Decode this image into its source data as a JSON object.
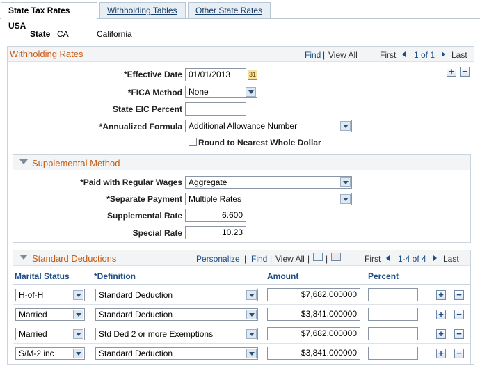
{
  "tabs": [
    {
      "label": "State Tax Rates USA"
    },
    {
      "label": "Withholding Tables"
    },
    {
      "label": "Other State Rates"
    }
  ],
  "state": {
    "label": "State",
    "code": "CA",
    "name": "California"
  },
  "withholding": {
    "title": "Withholding Rates",
    "find": "Find",
    "separator": "|",
    "view_all": "View All",
    "first": "First",
    "counter": "1 of 1",
    "last": "Last",
    "effective_date_label": "*Effective Date",
    "effective_date": "01/01/2013",
    "fica_label": "*FICA Method",
    "fica_value": "None",
    "eic_label": "State EIC Percent",
    "eic_value": "",
    "formula_label": "*Annualized Formula",
    "formula_value": "Additional Allowance Number",
    "round_label": "Round to Nearest Whole Dollar"
  },
  "supplemental": {
    "title": "Supplemental Method",
    "paid_label": "*Paid with Regular Wages",
    "paid_value": "Aggregate",
    "separate_label": "*Separate Payment",
    "separate_value": "Multiple Rates",
    "rate_label": "Supplemental Rate",
    "rate_value": "6.600",
    "special_label": "Special Rate",
    "special_value": "10.23"
  },
  "deductions": {
    "title": "Standard Deductions",
    "personalize": "Personalize",
    "find": "Find",
    "view_all": "View All",
    "first": "First",
    "counter": "1-4 of 4",
    "last": "Last",
    "columns": [
      "Marital Status",
      "*Definition",
      "Amount",
      "Percent"
    ],
    "rows": [
      {
        "status": "H-of-H",
        "definition": "Standard Deduction",
        "amount": "$7,682.000000",
        "percent": ""
      },
      {
        "status": "Married",
        "definition": "Standard Deduction",
        "amount": "$3,841.000000",
        "percent": ""
      },
      {
        "status": "Married",
        "definition": "Std Ded 2 or more Exemptions",
        "amount": "$7,682.000000",
        "percent": ""
      },
      {
        "status": "S/M-2 inc",
        "definition": "Standard Deduction",
        "amount": "$3,841.000000",
        "percent": ""
      }
    ]
  },
  "icons": {
    "add": "+",
    "remove": "−",
    "calendar": "31",
    "collapse": "triangle-down"
  }
}
